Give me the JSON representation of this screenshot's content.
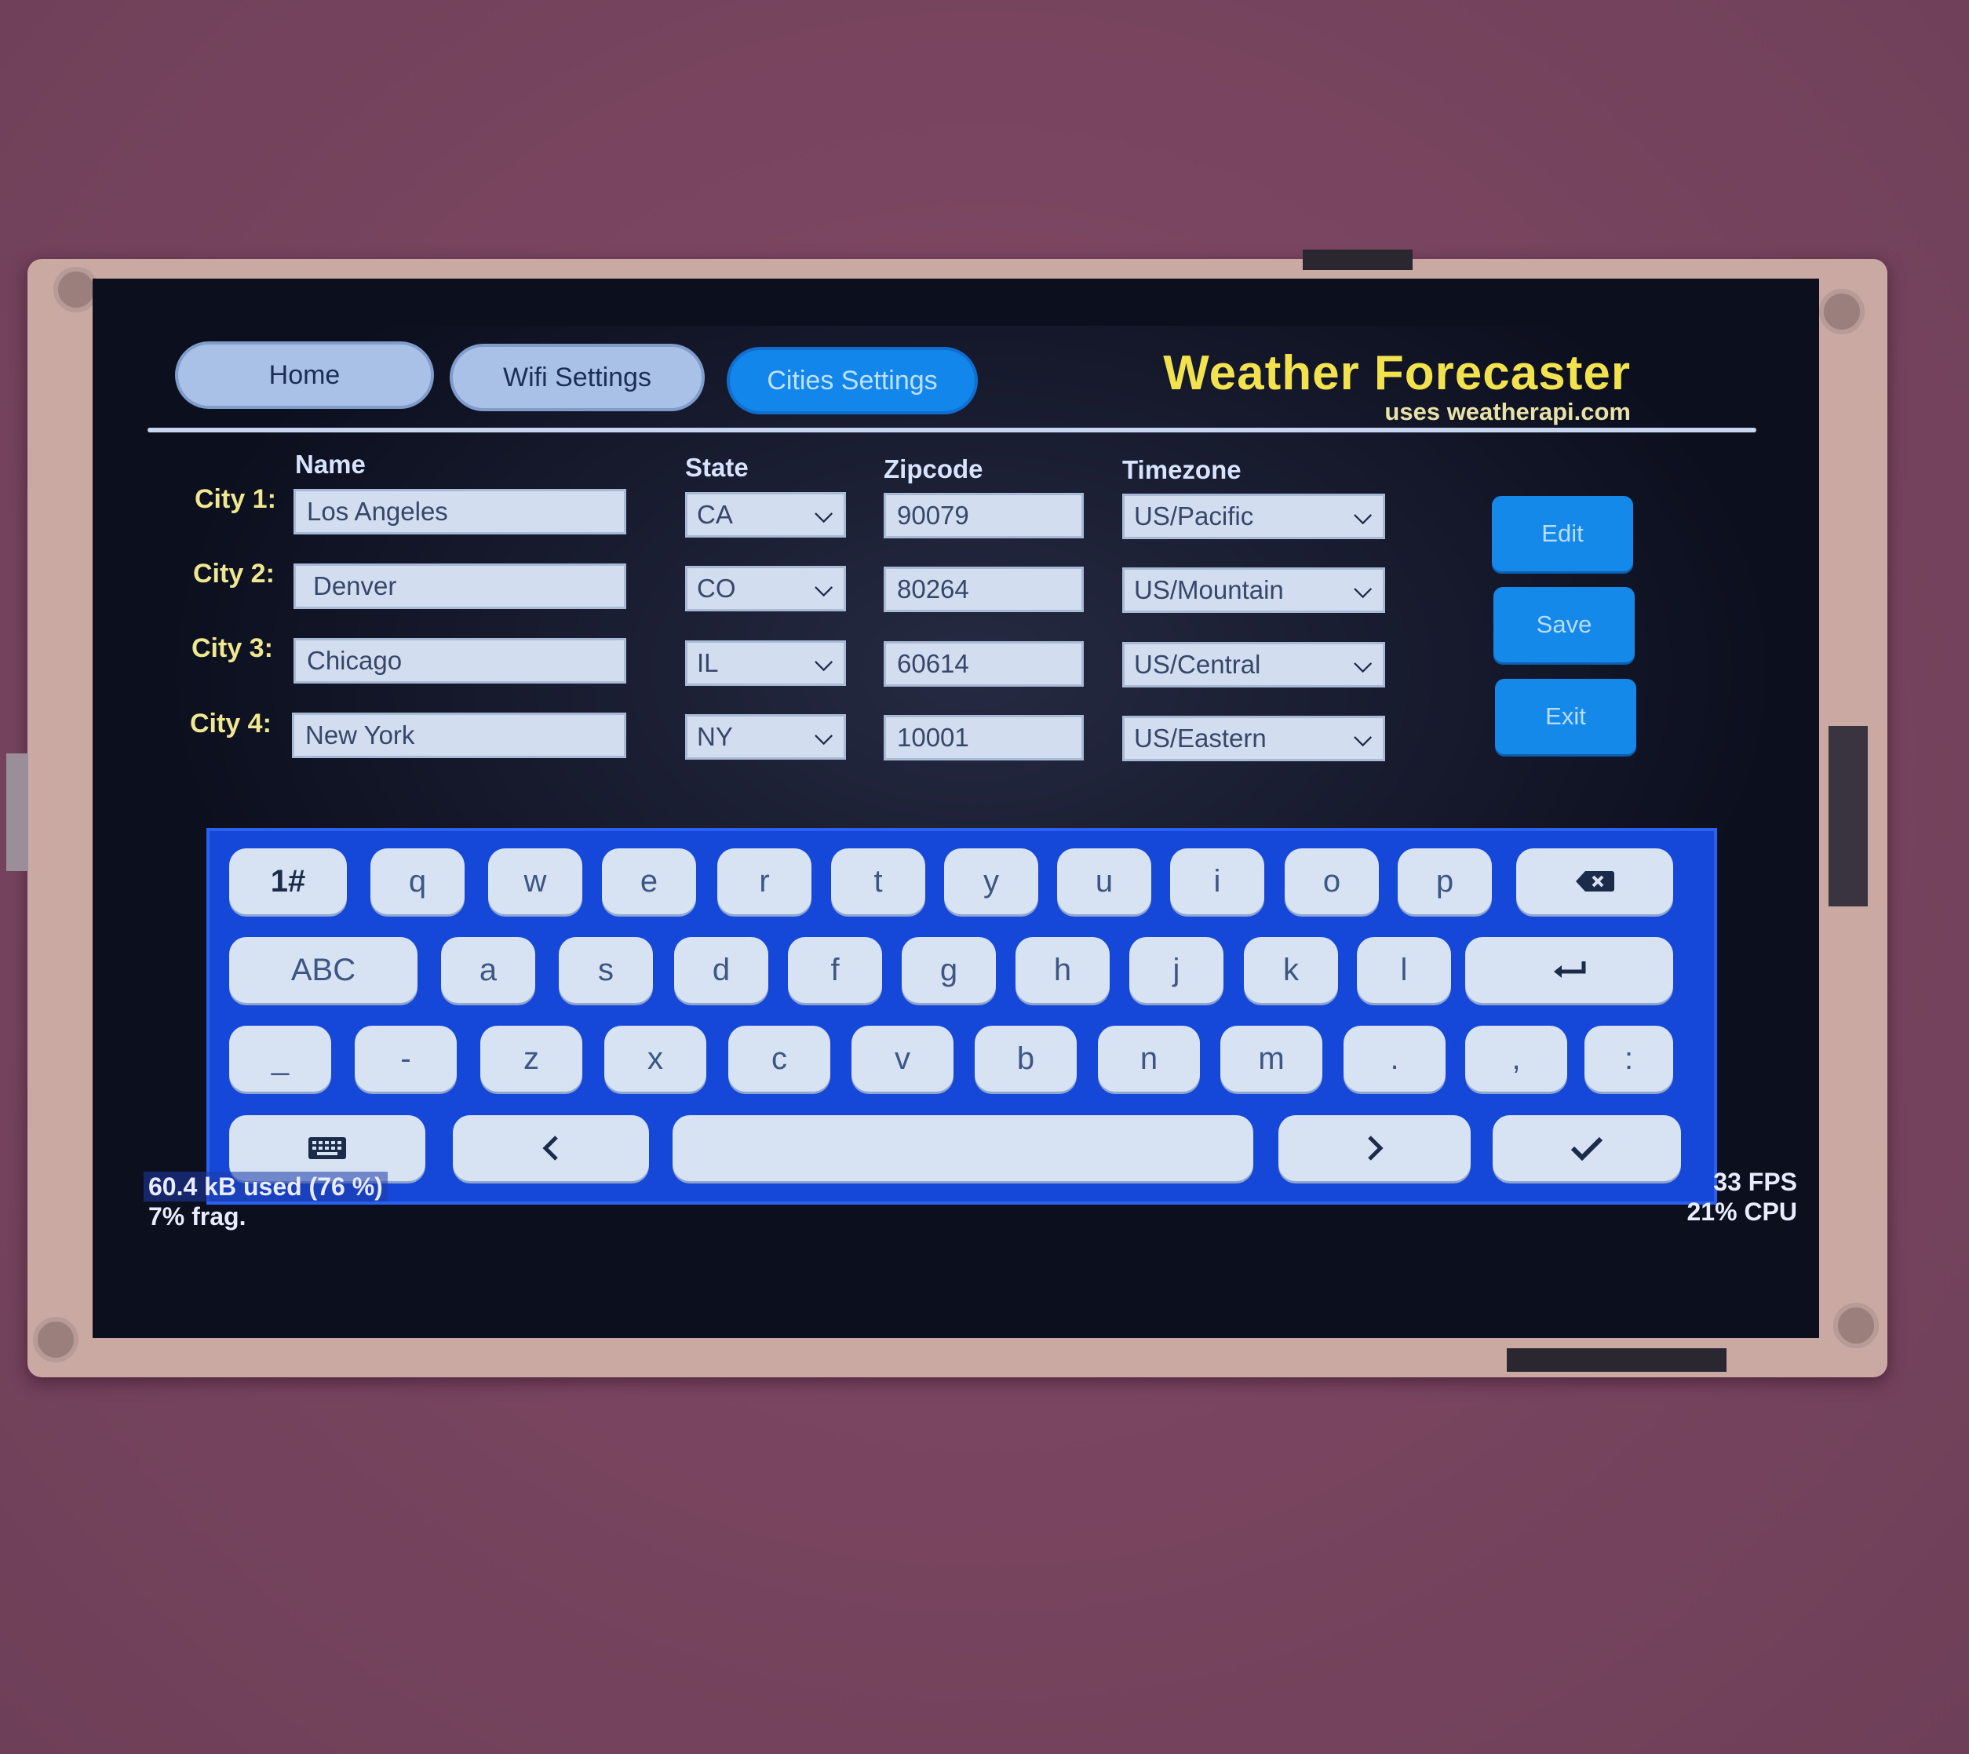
{
  "tabs": [
    {
      "label": "Home",
      "active": false
    },
    {
      "label": "Wifi Settings",
      "active": false
    },
    {
      "label": "Cities Settings",
      "active": true
    }
  ],
  "header": {
    "title": "Weather Forecaster",
    "subtitle": "uses weatherapi.com"
  },
  "columns": {
    "name": "Name",
    "state": "State",
    "zipcode": "Zipcode",
    "timezone": "Timezone"
  },
  "cities": [
    {
      "label": "City 1:",
      "name": "Los Angeles",
      "state": "CA",
      "zipcode": "90079",
      "timezone": "US/Pacific"
    },
    {
      "label": "City 2:",
      "name": "Denver",
      "state": "CO",
      "zipcode": "80264",
      "timezone": "US/Mountain"
    },
    {
      "label": "City 3:",
      "name": "Chicago",
      "state": "IL",
      "zipcode": "60614",
      "timezone": "US/Central"
    },
    {
      "label": "City 4:",
      "name": "New York",
      "state": "NY",
      "zipcode": "10001",
      "timezone": "US/Eastern"
    }
  ],
  "actions": {
    "edit": "Edit",
    "save": "Save",
    "exit": "Exit"
  },
  "keyboard": {
    "row1": [
      "1#",
      "q",
      "w",
      "e",
      "r",
      "t",
      "y",
      "u",
      "i",
      "o",
      "p"
    ],
    "row2": [
      "ABC",
      "a",
      "s",
      "d",
      "f",
      "g",
      "h",
      "j",
      "k",
      "l"
    ],
    "row3": [
      "_",
      "-",
      "z",
      "x",
      "c",
      "v",
      "b",
      "n",
      "m",
      ".",
      ",",
      ":"
    ],
    "icons": {
      "backspace": "backspace-icon",
      "enter": "enter-icon",
      "hide": "keyboard-icon",
      "left": "chevron-left-icon",
      "right": "chevron-right-icon",
      "ok": "checkmark-icon"
    }
  },
  "stats": {
    "memory": "60.4 kB used (76 %)",
    "frag": "7% frag.",
    "fps": "33 FPS",
    "cpu": "21% CPU"
  },
  "colors": {
    "accent": "#1286ea",
    "title": "#f2e24e",
    "keyboard_bg": "#1547d8"
  }
}
